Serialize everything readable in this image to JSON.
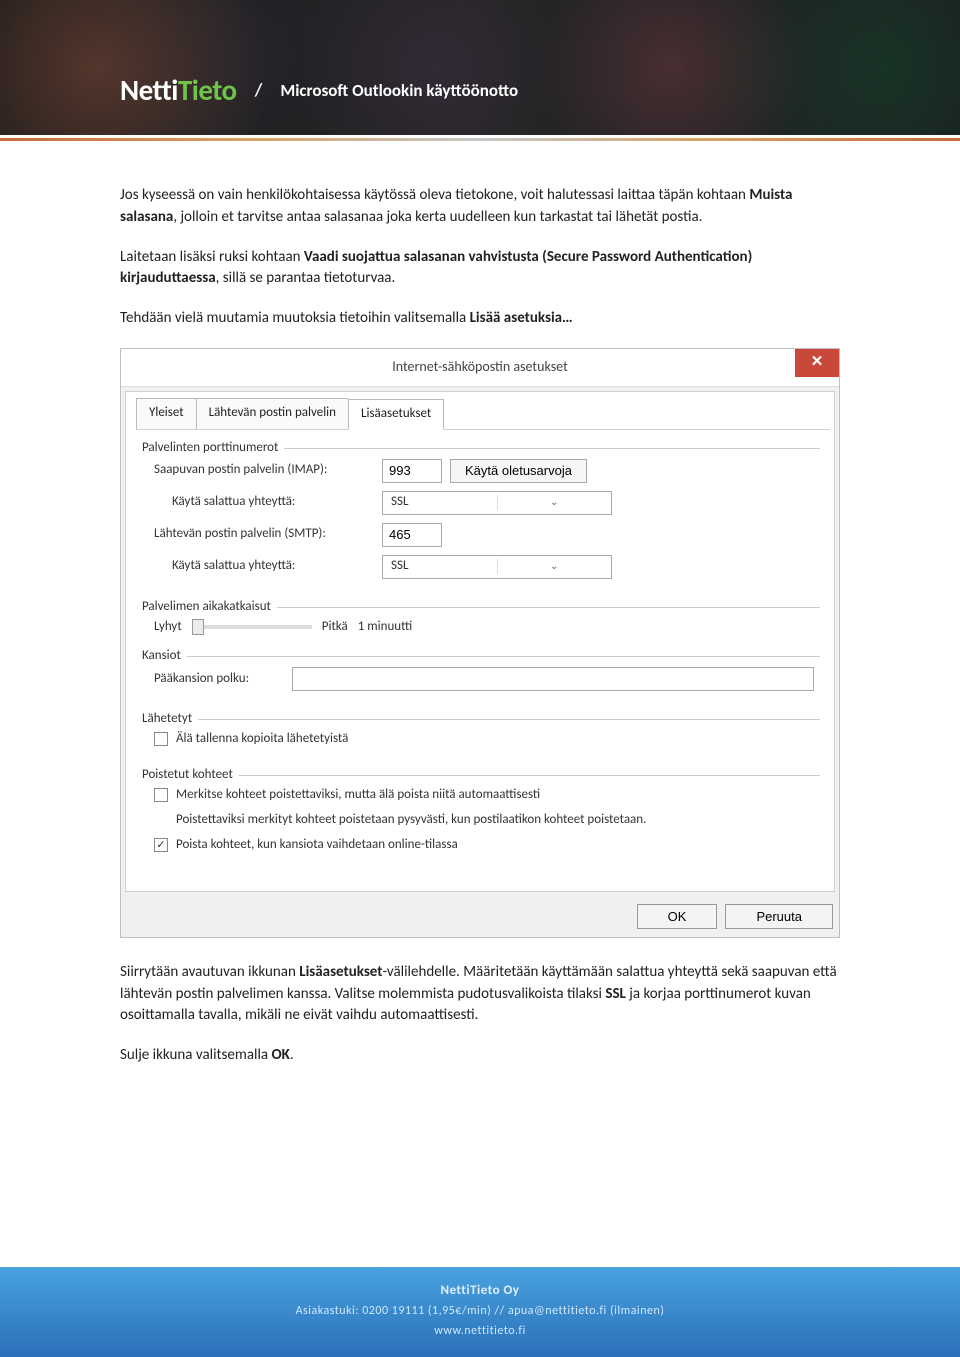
{
  "header": {
    "logo_part1": "Netti",
    "logo_part2": "Tieto",
    "separator": "/",
    "title": "Microsoft Outlookin käyttöönotto"
  },
  "body": {
    "p1_a": "Jos kyseessä on vain henkilökohtaisessa käytössä oleva tietokone, voit halutessasi laittaa täpän kohtaan ",
    "p1_b": "Muista salasana",
    "p1_c": ", jolloin et tarvitse antaa salasanaa joka kerta uudelleen kun tarkastat tai lähetät postia.",
    "p2_a": "Laitetaan lisäksi ruksi kohtaan ",
    "p2_b": "Vaadi suojattua salasanan vahvistusta (Secure Password Authentication) kirjauduttaessa",
    "p2_c": ", sillä se parantaa tietoturvaa.",
    "p3_a": "Tehdään vielä muutamia muutoksia tietoihin valitsemalla ",
    "p3_b": "Lisää asetuksia…",
    "p4_a": "Siirrytään avautuvan ikkunan ",
    "p4_b": "Lisäasetukset",
    "p4_c": "-välilehdelle. Määritetään käyttämään salattua yhteyttä sekä saapuvan että lähtevän postin palvelimen kanssa. Valitse molemmista pudotusvalikoista tilaksi ",
    "p4_d": "SSL",
    "p4_e": " ja korjaa porttinumerot kuvan osoittamalla tavalla, mikäli ne eivät vaihdu automaattisesti.",
    "p5_a": "Sulje ikkuna valitsemalla ",
    "p5_b": "OK",
    "p5_c": "."
  },
  "dialog": {
    "title": "Internet-sähköpostin asetukset",
    "tabs": [
      "Yleiset",
      "Lähtevän postin palvelin",
      "Lisäasetukset"
    ],
    "group_ports": "Palvelinten porttinumerot",
    "imap_label": "Saapuvan postin palvelin (IMAP):",
    "imap_port": "993",
    "defaults_btn": "Käytä oletusarvoja",
    "ssl_label": "Käytä salattua yhteyttä:",
    "ssl_value": "SSL",
    "smtp_label": "Lähtevän postin palvelin (SMTP):",
    "smtp_port": "465",
    "group_timeout": "Palvelimen aikakatkaisut",
    "timeout_short": "Lyhyt",
    "timeout_long": "Pitkä",
    "timeout_value": "1 minuutti",
    "group_folders": "Kansiot",
    "root_label": "Pääkansion polku:",
    "group_sent": "Lähetetyt",
    "sent_checkbox": "Älä tallenna kopioita lähetetyistä",
    "group_deleted": "Poistetut kohteet",
    "del_chk1": "Merkitse kohteet poistettaviksi, mutta älä poista niitä automaattisesti",
    "del_note": "Poistettaviksi merkityt kohteet poistetaan pysyvästi, kun postilaatikon kohteet poistetaan.",
    "del_chk2": "Poista kohteet, kun kansiota vaihdetaan online-tilassa",
    "ok": "OK",
    "cancel": "Peruuta"
  },
  "footer": {
    "company": "NettiTieto Oy",
    "line2": "Asiakastuki: 0200 19111 (1,95€/min)   //   apua@nettitieto.fi (ilmainen)",
    "line3": "www.nettitieto.fi"
  }
}
